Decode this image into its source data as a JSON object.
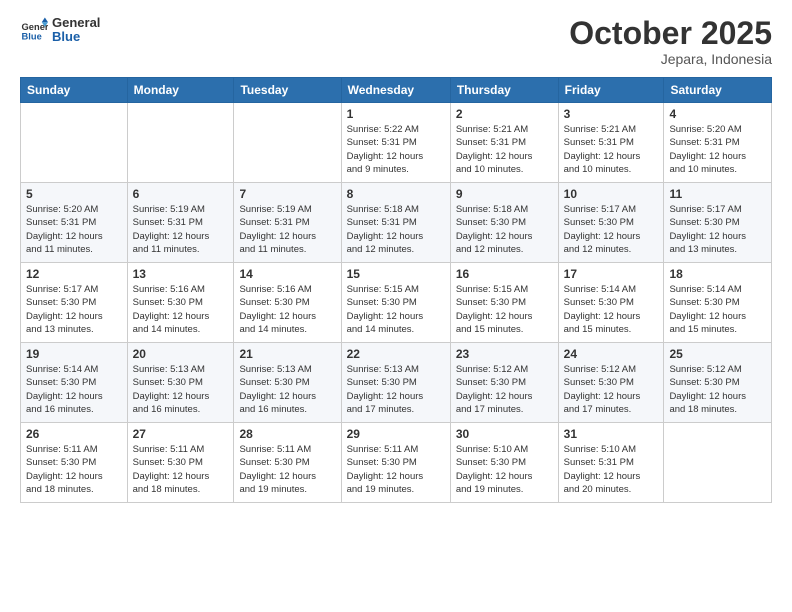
{
  "logo": {
    "line1": "General",
    "line2": "Blue"
  },
  "header": {
    "month": "October 2025",
    "location": "Jepara, Indonesia"
  },
  "weekdays": [
    "Sunday",
    "Monday",
    "Tuesday",
    "Wednesday",
    "Thursday",
    "Friday",
    "Saturday"
  ],
  "weeks": [
    [
      {
        "day": "",
        "info": ""
      },
      {
        "day": "",
        "info": ""
      },
      {
        "day": "",
        "info": ""
      },
      {
        "day": "1",
        "info": "Sunrise: 5:22 AM\nSunset: 5:31 PM\nDaylight: 12 hours\nand 9 minutes."
      },
      {
        "day": "2",
        "info": "Sunrise: 5:21 AM\nSunset: 5:31 PM\nDaylight: 12 hours\nand 10 minutes."
      },
      {
        "day": "3",
        "info": "Sunrise: 5:21 AM\nSunset: 5:31 PM\nDaylight: 12 hours\nand 10 minutes."
      },
      {
        "day": "4",
        "info": "Sunrise: 5:20 AM\nSunset: 5:31 PM\nDaylight: 12 hours\nand 10 minutes."
      }
    ],
    [
      {
        "day": "5",
        "info": "Sunrise: 5:20 AM\nSunset: 5:31 PM\nDaylight: 12 hours\nand 11 minutes."
      },
      {
        "day": "6",
        "info": "Sunrise: 5:19 AM\nSunset: 5:31 PM\nDaylight: 12 hours\nand 11 minutes."
      },
      {
        "day": "7",
        "info": "Sunrise: 5:19 AM\nSunset: 5:31 PM\nDaylight: 12 hours\nand 11 minutes."
      },
      {
        "day": "8",
        "info": "Sunrise: 5:18 AM\nSunset: 5:31 PM\nDaylight: 12 hours\nand 12 minutes."
      },
      {
        "day": "9",
        "info": "Sunrise: 5:18 AM\nSunset: 5:30 PM\nDaylight: 12 hours\nand 12 minutes."
      },
      {
        "day": "10",
        "info": "Sunrise: 5:17 AM\nSunset: 5:30 PM\nDaylight: 12 hours\nand 12 minutes."
      },
      {
        "day": "11",
        "info": "Sunrise: 5:17 AM\nSunset: 5:30 PM\nDaylight: 12 hours\nand 13 minutes."
      }
    ],
    [
      {
        "day": "12",
        "info": "Sunrise: 5:17 AM\nSunset: 5:30 PM\nDaylight: 12 hours\nand 13 minutes."
      },
      {
        "day": "13",
        "info": "Sunrise: 5:16 AM\nSunset: 5:30 PM\nDaylight: 12 hours\nand 14 minutes."
      },
      {
        "day": "14",
        "info": "Sunrise: 5:16 AM\nSunset: 5:30 PM\nDaylight: 12 hours\nand 14 minutes."
      },
      {
        "day": "15",
        "info": "Sunrise: 5:15 AM\nSunset: 5:30 PM\nDaylight: 12 hours\nand 14 minutes."
      },
      {
        "day": "16",
        "info": "Sunrise: 5:15 AM\nSunset: 5:30 PM\nDaylight: 12 hours\nand 15 minutes."
      },
      {
        "day": "17",
        "info": "Sunrise: 5:14 AM\nSunset: 5:30 PM\nDaylight: 12 hours\nand 15 minutes."
      },
      {
        "day": "18",
        "info": "Sunrise: 5:14 AM\nSunset: 5:30 PM\nDaylight: 12 hours\nand 15 minutes."
      }
    ],
    [
      {
        "day": "19",
        "info": "Sunrise: 5:14 AM\nSunset: 5:30 PM\nDaylight: 12 hours\nand 16 minutes."
      },
      {
        "day": "20",
        "info": "Sunrise: 5:13 AM\nSunset: 5:30 PM\nDaylight: 12 hours\nand 16 minutes."
      },
      {
        "day": "21",
        "info": "Sunrise: 5:13 AM\nSunset: 5:30 PM\nDaylight: 12 hours\nand 16 minutes."
      },
      {
        "day": "22",
        "info": "Sunrise: 5:13 AM\nSunset: 5:30 PM\nDaylight: 12 hours\nand 17 minutes."
      },
      {
        "day": "23",
        "info": "Sunrise: 5:12 AM\nSunset: 5:30 PM\nDaylight: 12 hours\nand 17 minutes."
      },
      {
        "day": "24",
        "info": "Sunrise: 5:12 AM\nSunset: 5:30 PM\nDaylight: 12 hours\nand 17 minutes."
      },
      {
        "day": "25",
        "info": "Sunrise: 5:12 AM\nSunset: 5:30 PM\nDaylight: 12 hours\nand 18 minutes."
      }
    ],
    [
      {
        "day": "26",
        "info": "Sunrise: 5:11 AM\nSunset: 5:30 PM\nDaylight: 12 hours\nand 18 minutes."
      },
      {
        "day": "27",
        "info": "Sunrise: 5:11 AM\nSunset: 5:30 PM\nDaylight: 12 hours\nand 18 minutes."
      },
      {
        "day": "28",
        "info": "Sunrise: 5:11 AM\nSunset: 5:30 PM\nDaylight: 12 hours\nand 19 minutes."
      },
      {
        "day": "29",
        "info": "Sunrise: 5:11 AM\nSunset: 5:30 PM\nDaylight: 12 hours\nand 19 minutes."
      },
      {
        "day": "30",
        "info": "Sunrise: 5:10 AM\nSunset: 5:30 PM\nDaylight: 12 hours\nand 19 minutes."
      },
      {
        "day": "31",
        "info": "Sunrise: 5:10 AM\nSunset: 5:31 PM\nDaylight: 12 hours\nand 20 minutes."
      },
      {
        "day": "",
        "info": ""
      }
    ]
  ]
}
